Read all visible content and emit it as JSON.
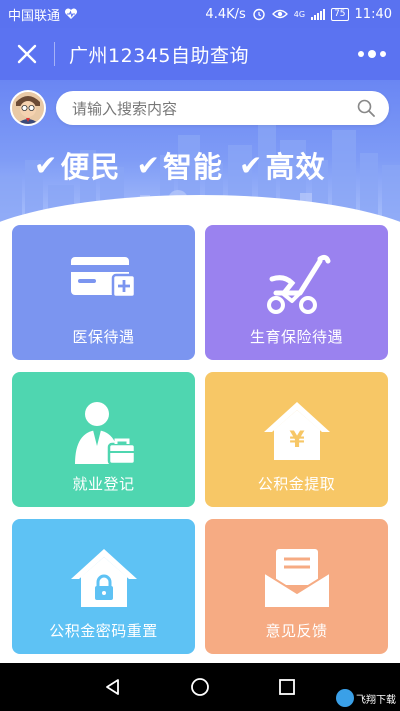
{
  "status_bar": {
    "carrier": "中国联通",
    "speed": "4.4K/s",
    "network": "4G",
    "battery": "75",
    "time": "11:40"
  },
  "title_bar": {
    "title": "广州12345自助查询"
  },
  "search": {
    "placeholder": "请输入搜索内容"
  },
  "slogan": {
    "items": [
      "便民",
      "智能",
      "高效"
    ]
  },
  "tiles": [
    {
      "label": "医保待遇",
      "color": "#7b95f0",
      "icon": "medical-card-icon"
    },
    {
      "label": "生育保险待遇",
      "color": "#9a82ef",
      "icon": "stroller-icon"
    },
    {
      "label": "就业登记",
      "color": "#4fd6b0",
      "icon": "employee-icon"
    },
    {
      "label": "公积金提取",
      "color": "#f7c766",
      "icon": "fund-house-icon"
    },
    {
      "label": "公积金密码重置",
      "color": "#5ec2f4",
      "icon": "house-lock-icon"
    },
    {
      "label": "意见反馈",
      "color": "#f6ab83",
      "icon": "envelope-icon"
    }
  ],
  "colors": {
    "header": "#5b73f1"
  },
  "watermark": {
    "text": "飞翔下载"
  }
}
